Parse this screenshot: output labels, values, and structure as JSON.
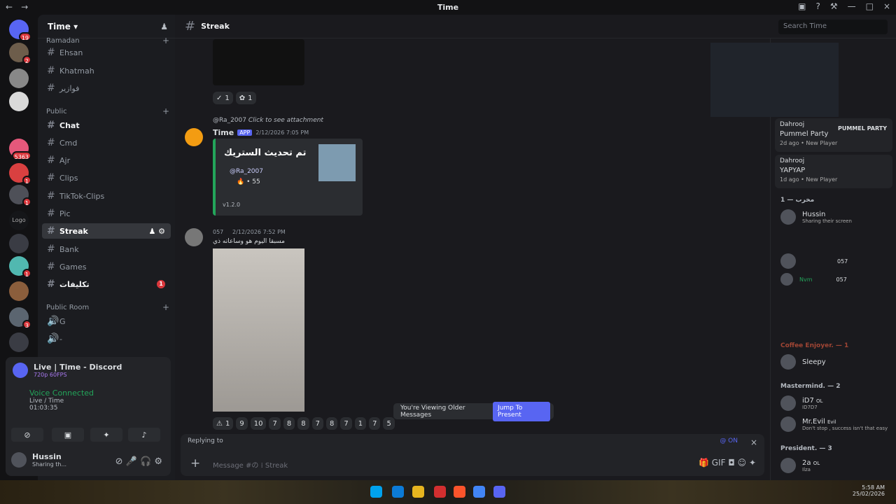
{
  "window": {
    "title": "Time",
    "back": "←",
    "forward": "→"
  },
  "servers": [
    {
      "badge": "19"
    },
    {
      "badge": "2"
    },
    {
      "badge": ""
    },
    {
      "badge": ""
    },
    {
      "badge": "5363"
    },
    {
      "badge": "1"
    },
    {
      "badge": "1"
    },
    {
      "badge": ""
    },
    {
      "badge": "1"
    },
    {
      "badge": "3"
    }
  ],
  "sidebar": {
    "server": "Time",
    "categories": [
      {
        "name": "Ramadan"
      },
      {
        "name": "Public"
      },
      {
        "name": "Public Room"
      }
    ],
    "channels": [
      "Ehsan",
      "Khatmah",
      "فوازير",
      "Chat",
      "Cmd",
      "Ajr",
      "Clips",
      "TikTok-Clips",
      "Pic",
      "Streak",
      "Bank",
      "Games",
      "تكليفات",
      "G",
      "-"
    ],
    "unread": "1"
  },
  "live": {
    "title": "Live | Time - Discord",
    "quality": "720p 60FPS",
    "status": "Voice Connected",
    "channel": "Live / Time",
    "time": "01:03:35"
  },
  "user": {
    "name": "Hussin",
    "status": "Sharing th..."
  },
  "channel": {
    "name": "Streak",
    "icon": "#",
    "search": "Search Time"
  },
  "messages": {
    "replyUser": "@Ra_2007",
    "replyText": "Click to see attachment",
    "author": "Time",
    "badge": "APP",
    "time1": "2/12/2026 7:05 PM",
    "embedTitle": "تم تحديث الستريك",
    "mention": "@Ra_2007",
    "streak": "55",
    "version": "v1.2.0",
    "time2": "2/12/2026 7:52 PM",
    "tag": "057",
    "caption": "مسبقا اليوم هو وساعاته ذي",
    "older": "You're Viewing Older Messages",
    "jump": "Jump To Present",
    "replying": "Replying to",
    "on": "@ ON",
    "placeholder": "Message #の ⁞ Streak"
  },
  "reactionsTop": [
    "1",
    "1"
  ],
  "reactionsBottom": [
    "1",
    "9",
    "10",
    "7",
    "8",
    "8",
    "7",
    "8",
    "7",
    "1",
    "7",
    "5"
  ],
  "members": {
    "activity1": {
      "user": "Dahrooj",
      "game": "Pummel Party",
      "meta": "2d ago • New Player",
      "logo": "PUMMEL PARTY"
    },
    "activity2": {
      "user": "Dahrooj",
      "game": "YAPYAP",
      "meta": "1d ago • New Player"
    },
    "groups": [
      {
        "name": "مخرب — 1"
      },
      {
        "name": "Coffee Enjoyer. — 1"
      },
      {
        "name": "Mastermind. — 2"
      },
      {
        "name": "President. — 3"
      }
    ],
    "people": [
      {
        "name": "Hussin",
        "sub": "Sharing their screen"
      },
      {
        "name": "Sleepy",
        "sub": ""
      },
      {
        "name": "iD7",
        "sub": "ID7D7"
      },
      {
        "name": "Mr.Evil",
        "sub": "Don't stop , success isn't that easy"
      },
      {
        "name": "2a",
        "sub": "Ilza"
      }
    ],
    "tags": [
      "057",
      "057",
      "OL",
      "Evil",
      "OL"
    ],
    "nvm": "Nvm",
    "nine": "3"
  },
  "taskbar": {
    "time": "5:58 AM",
    "date": "25/02/2026"
  }
}
